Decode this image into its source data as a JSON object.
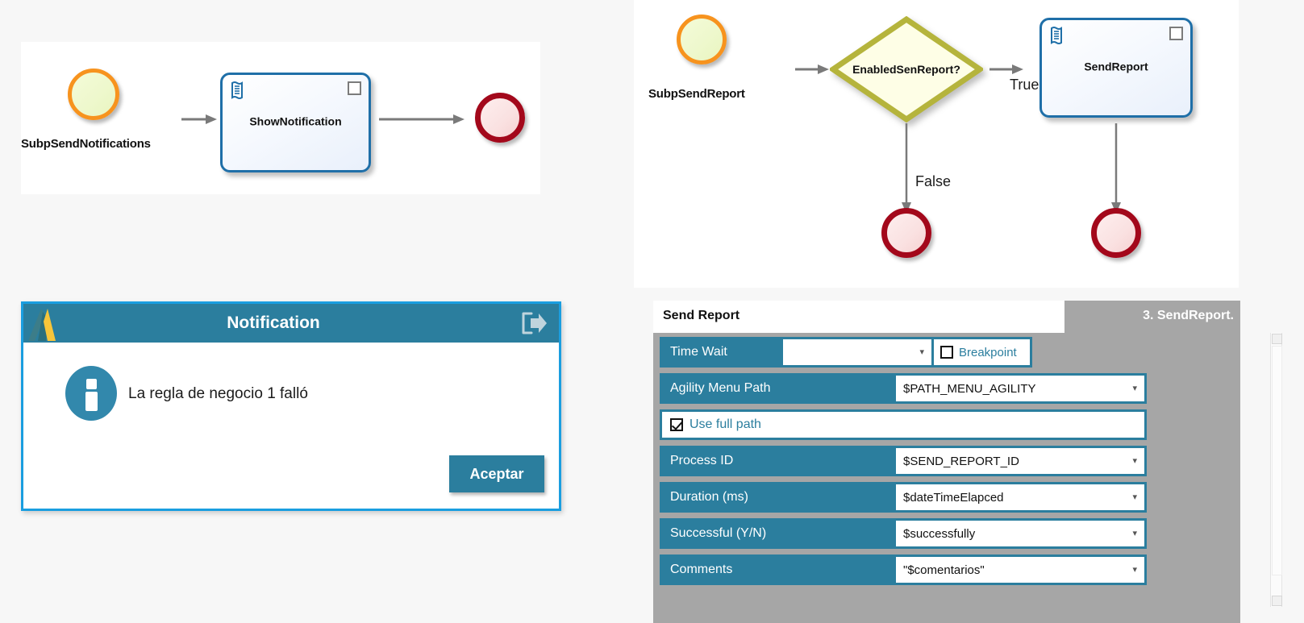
{
  "colors": {
    "start_event_stroke": "#f7931e",
    "start_event_fill": "#eef8cd",
    "end_event_stroke": "#a3081b",
    "end_event_fill": "#fae1e1",
    "task_stroke": "#1f6fa8",
    "task_fill": "#eef3fb",
    "gateway_stroke": "#b5b43c",
    "gateway_fill": "#fefee6",
    "dialog_accent": "#2b7e9e",
    "dialog_border": "#1a9ee0",
    "panel_gray": "#a6a6a6",
    "arrow_gray": "#7a7a7a"
  },
  "diagram_notifications": {
    "name": "SubpSendNotifications-diagram",
    "start_event": {
      "label": "SubpSendNotifications",
      "icon": "start-event-circle"
    },
    "task": {
      "label": "ShowNotification",
      "type_icon": "script-task-icon",
      "marker_icon": "subprocess-marker-icon"
    },
    "end_event": {
      "icon": "end-event-circle"
    },
    "connectors": [
      {
        "icon": "arrow-right-icon",
        "label": ""
      },
      {
        "icon": "arrow-right-icon",
        "label": ""
      }
    ]
  },
  "diagram_sendreport": {
    "name": "SubpSendReport-diagram",
    "start_event": {
      "label": "SubpSendReport",
      "icon": "start-event-circle"
    },
    "gateway": {
      "label": "EnabledSenReport?",
      "icon": "exclusive-gateway-diamond"
    },
    "task": {
      "label": "SendReport",
      "type_icon": "script-task-icon",
      "marker_icon": "subprocess-marker-icon"
    },
    "flow_labels": {
      "true": "True",
      "false": "False"
    },
    "end_events": [
      {
        "icon": "end-event-circle"
      },
      {
        "icon": "end-event-circle"
      }
    ]
  },
  "notification_dialog": {
    "title": "Notification",
    "logo_icon": "agility-logo-icon",
    "exit_icon": "exit-arrow-icon",
    "info_icon": "info-circle-icon",
    "message": "La regla de negocio 1 falló",
    "accept_label": "Aceptar"
  },
  "send_report_form": {
    "header_title": "Send Report",
    "step_label": "3. SendReport.",
    "rows": [
      {
        "label": "Time Wait",
        "value": "",
        "caret_icon": "chevron-down-icon",
        "breakpoint": {
          "label": "Breakpoint",
          "checked": false,
          "icon": "checkbox-icon"
        }
      },
      {
        "label": "Agility Menu Path",
        "value": "$PATH_MENU_AGILITY",
        "caret_icon": "chevron-down-icon"
      },
      {
        "label": "Use full path",
        "checked": true,
        "icon": "checkbox-checked-icon",
        "type": "checkbox"
      },
      {
        "label": "Process ID",
        "value": "$SEND_REPORT_ID",
        "caret_icon": "chevron-down-icon"
      },
      {
        "label": "Duration (ms)",
        "value": "$dateTimeElapced",
        "caret_icon": "chevron-down-icon"
      },
      {
        "label": "Successful (Y/N)",
        "value": "$successfully",
        "caret_icon": "chevron-down-icon"
      },
      {
        "label": "Comments",
        "value": "\"$comentarios\"",
        "caret_icon": "chevron-down-icon"
      }
    ]
  },
  "scrollbar": {
    "up_icon": "scroll-up-arrow-icon",
    "down_icon": "scroll-down-arrow-icon",
    "thumb": "scroll-thumb"
  }
}
